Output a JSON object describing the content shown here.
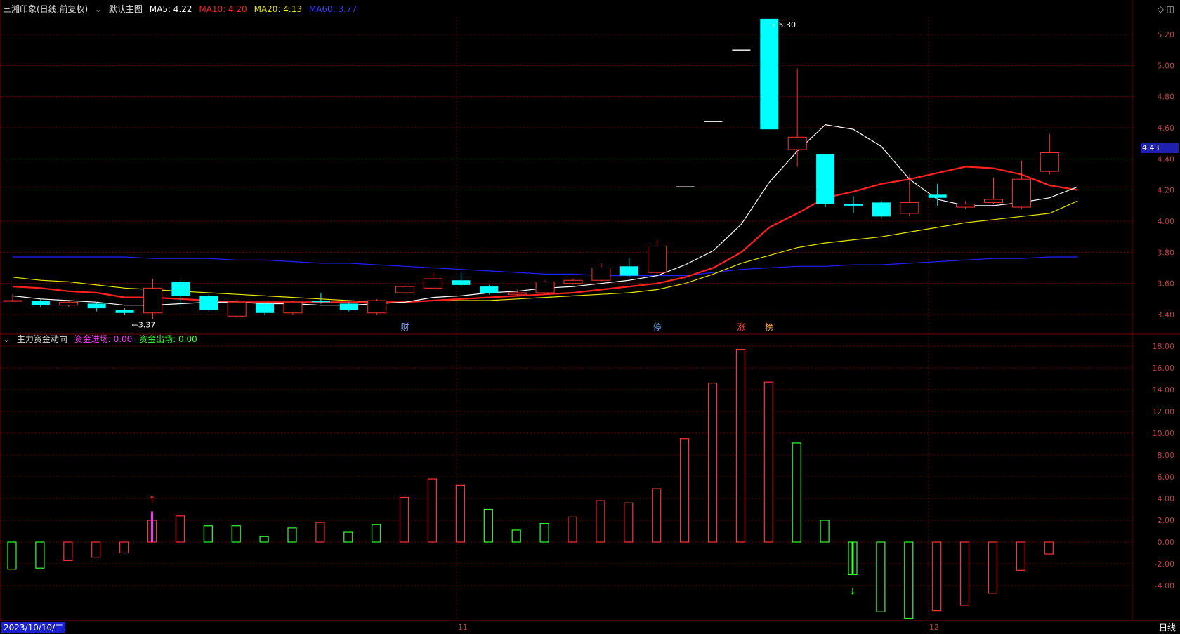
{
  "header": {
    "stock_name": "三湘印象(日线,前复权)",
    "main_chart_name": "默认主图",
    "ma5": "MA5: 4.22",
    "ma10": "MA10: 4.20",
    "ma20": "MA20: 4.13",
    "ma60": "MA60: 3.77"
  },
  "sub_header": {
    "indicator_name": "主力资金动向",
    "inflow": "资金进场: 0.00",
    "outflow": "资金出场: 0.00"
  },
  "footer": {
    "date": "2023/10/10/二",
    "period": "日线",
    "month_11": "11",
    "month_12": "12"
  },
  "last_price": "4.43",
  "colors": {
    "up": "#ff3232",
    "down": "#00ffff",
    "ma5": "#ffffff",
    "ma10": "#ff2020",
    "ma20": "#e6e600",
    "ma60": "#2020ff",
    "grid": "#7a0000",
    "axis_text": "#c04040",
    "inflow_text": "#ff33ff",
    "outflow_text": "#33ff33"
  },
  "chart_data": [
    {
      "type": "candlestick",
      "ylim": [
        3.3,
        5.3
      ],
      "y_ticks": [
        "5.20",
        "5.00",
        "4.80",
        "4.60",
        "4.40",
        "4.20",
        "4.00",
        "3.80",
        "3.60",
        "3.40"
      ],
      "annotations": {
        "high_label": "5.30",
        "low_label": "3.37"
      },
      "event_markers": [
        "财",
        "停",
        "涨",
        "榜"
      ],
      "candles": [
        {
          "o": 3.49,
          "c": 3.49,
          "h": 3.53,
          "l": 3.48
        },
        {
          "o": 3.49,
          "c": 3.46,
          "h": 3.5,
          "l": 3.45
        },
        {
          "o": 3.46,
          "c": 3.48,
          "h": 3.49,
          "l": 3.45
        },
        {
          "o": 3.47,
          "c": 3.44,
          "h": 3.48,
          "l": 3.42
        },
        {
          "o": 3.43,
          "c": 3.41,
          "h": 3.44,
          "l": 3.4
        },
        {
          "o": 3.41,
          "c": 3.57,
          "h": 3.63,
          "l": 3.37
        },
        {
          "o": 3.61,
          "c": 3.52,
          "h": 3.62,
          "l": 3.45
        },
        {
          "o": 3.52,
          "c": 3.43,
          "h": 3.53,
          "l": 3.42
        },
        {
          "o": 3.39,
          "c": 3.48,
          "h": 3.5,
          "l": 3.38
        },
        {
          "o": 3.47,
          "c": 3.41,
          "h": 3.48,
          "l": 3.4
        },
        {
          "o": 3.41,
          "c": 3.48,
          "h": 3.49,
          "l": 3.4
        },
        {
          "o": 3.49,
          "c": 3.48,
          "h": 3.54,
          "l": 3.47
        },
        {
          "o": 3.47,
          "c": 3.43,
          "h": 3.48,
          "l": 3.42
        },
        {
          "o": 3.41,
          "c": 3.49,
          "h": 3.5,
          "l": 3.4
        },
        {
          "o": 3.54,
          "c": 3.58,
          "h": 3.59,
          "l": 3.53
        },
        {
          "o": 3.57,
          "c": 3.63,
          "h": 3.67,
          "l": 3.56
        },
        {
          "o": 3.62,
          "c": 3.59,
          "h": 3.67,
          "l": 3.58
        },
        {
          "o": 3.58,
          "c": 3.54,
          "h": 3.59,
          "l": 3.53
        },
        {
          "o": 3.53,
          "c": 3.54,
          "h": 3.56,
          "l": 3.52
        },
        {
          "o": 3.54,
          "c": 3.61,
          "h": 3.62,
          "l": 3.53
        },
        {
          "o": 3.6,
          "c": 3.62,
          "h": 3.63,
          "l": 3.59
        },
        {
          "o": 3.62,
          "c": 3.7,
          "h": 3.73,
          "l": 3.61
        },
        {
          "o": 3.71,
          "c": 3.65,
          "h": 3.76,
          "l": 3.64
        },
        {
          "o": 3.67,
          "c": 3.84,
          "h": 3.88,
          "l": 3.66
        },
        {
          "o": 4.22,
          "c": 4.22,
          "h": 4.22,
          "l": 4.22
        },
        {
          "o": 4.64,
          "c": 4.64,
          "h": 4.64,
          "l": 4.64
        },
        {
          "o": 5.1,
          "c": 5.1,
          "h": 5.1,
          "l": 5.1
        },
        {
          "o": 5.3,
          "c": 4.59,
          "h": 5.3,
          "l": 4.59
        },
        {
          "o": 4.46,
          "c": 4.54,
          "h": 4.98,
          "l": 4.35
        },
        {
          "o": 4.43,
          "c": 4.11,
          "h": 4.43,
          "l": 4.09
        },
        {
          "o": 4.11,
          "c": 4.1,
          "h": 4.16,
          "l": 4.05
        },
        {
          "o": 4.12,
          "c": 4.03,
          "h": 4.13,
          "l": 4.02
        },
        {
          "o": 4.05,
          "c": 4.12,
          "h": 4.3,
          "l": 4.03
        },
        {
          "o": 4.17,
          "c": 4.15,
          "h": 4.24,
          "l": 4.1
        },
        {
          "o": 4.09,
          "c": 4.11,
          "h": 4.13,
          "l": 4.08
        },
        {
          "o": 4.12,
          "c": 4.14,
          "h": 4.28,
          "l": 4.11
        },
        {
          "o": 4.09,
          "c": 4.27,
          "h": 4.39,
          "l": 4.08
        },
        {
          "o": 4.32,
          "c": 4.44,
          "h": 4.56,
          "l": 4.3
        }
      ],
      "ma5": [
        3.52,
        3.5,
        3.49,
        3.48,
        3.46,
        3.46,
        3.47,
        3.48,
        3.48,
        3.47,
        3.47,
        3.46,
        3.46,
        3.47,
        3.48,
        3.51,
        3.52,
        3.54,
        3.55,
        3.57,
        3.58,
        3.6,
        3.62,
        3.65,
        3.72,
        3.81,
        3.98,
        4.25,
        4.45,
        4.62,
        4.59,
        4.48,
        4.27,
        4.14,
        4.1,
        4.1,
        4.12,
        4.15,
        4.22
      ],
      "ma10": [
        3.58,
        3.57,
        3.55,
        3.54,
        3.51,
        3.51,
        3.5,
        3.49,
        3.48,
        3.48,
        3.48,
        3.48,
        3.48,
        3.48,
        3.48,
        3.49,
        3.5,
        3.51,
        3.52,
        3.53,
        3.54,
        3.56,
        3.58,
        3.6,
        3.64,
        3.7,
        3.8,
        3.96,
        4.05,
        4.15,
        4.19,
        4.24,
        4.27,
        4.31,
        4.35,
        4.34,
        4.3,
        4.23,
        4.2
      ],
      "ma20": [
        3.64,
        3.62,
        3.61,
        3.59,
        3.57,
        3.56,
        3.55,
        3.54,
        3.53,
        3.52,
        3.51,
        3.5,
        3.49,
        3.48,
        3.48,
        3.49,
        3.49,
        3.49,
        3.5,
        3.51,
        3.52,
        3.53,
        3.54,
        3.56,
        3.6,
        3.66,
        3.73,
        3.78,
        3.83,
        3.86,
        3.88,
        3.9,
        3.93,
        3.96,
        3.99,
        4.01,
        4.03,
        4.05,
        4.13
      ],
      "ma60": [
        3.77,
        3.77,
        3.77,
        3.77,
        3.77,
        3.76,
        3.76,
        3.76,
        3.75,
        3.75,
        3.74,
        3.73,
        3.73,
        3.72,
        3.71,
        3.7,
        3.69,
        3.68,
        3.67,
        3.66,
        3.66,
        3.65,
        3.65,
        3.65,
        3.65,
        3.67,
        3.69,
        3.7,
        3.71,
        3.71,
        3.72,
        3.72,
        3.73,
        3.74,
        3.75,
        3.76,
        3.76,
        3.77,
        3.77
      ]
    },
    {
      "type": "bar",
      "title": "主力资金动向",
      "ylim": [
        -6.4,
        18.8
      ],
      "y_ticks": [
        "18.00",
        "16.00",
        "14.00",
        "12.00",
        "10.00",
        "8.00",
        "6.00",
        "4.00",
        "2.00",
        "0.00",
        "-2.00",
        "-4.00"
      ],
      "values": [
        -2.5,
        -2.4,
        -1.7,
        -1.4,
        -1.0,
        2.0,
        2.4,
        1.5,
        1.5,
        0.5,
        1.3,
        1.8,
        0.9,
        1.6,
        4.1,
        5.8,
        5.2,
        3.0,
        1.1,
        1.7,
        2.3,
        3.8,
        3.6,
        4.9,
        9.5,
        14.6,
        17.7,
        14.7,
        9.1,
        2.0,
        -3.0,
        -6.4,
        -7.0,
        -6.3,
        -5.8,
        -4.7,
        -2.6,
        -1.1
      ],
      "up_down": [
        "down",
        "down",
        "up",
        "up",
        "up",
        "up",
        "up",
        "down",
        "down",
        "down",
        "down",
        "up",
        "down",
        "down",
        "up",
        "up",
        "up",
        "down",
        "down",
        "down",
        "up",
        "up",
        "up",
        "up",
        "up",
        "up",
        "up",
        "up",
        "down",
        "down",
        "down",
        "down",
        "down",
        "up",
        "up",
        "up",
        "up",
        "up"
      ],
      "markers": {
        "up_arrow_index": 5,
        "down_arrow_index": 30
      }
    }
  ]
}
